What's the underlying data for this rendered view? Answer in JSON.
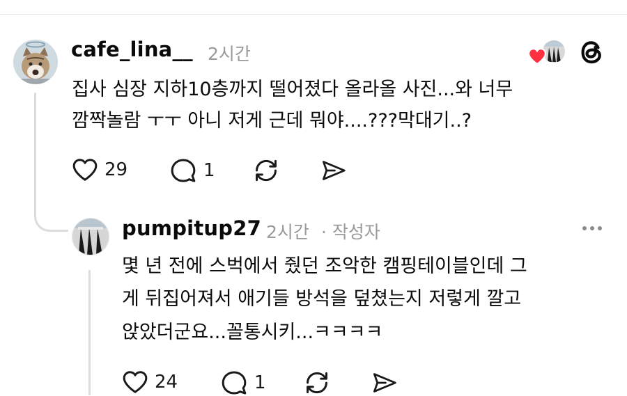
{
  "post": {
    "username": "cafe_lina__",
    "time": "2시간",
    "text_lines": [
      "집사 심장 지하10층까지 떨어졌다 올라올 사진...와 너무",
      "깜짝놀람 ㅜㅜ 아니 저게 근데 뭐야....???막대기..?"
    ],
    "likes": "29",
    "replies": "1"
  },
  "reply": {
    "username": "pumpitup27",
    "time": "2시간",
    "author_tag": "· 작성자",
    "text_lines": [
      "몇 년 전에 스벅에서 줬던 조악한 캠핑테이블인데 그",
      "게 뒤집어져서 애기들 방석을 덮쳤는지 저렇게 깔고",
      "앉았더군요...꼴통시키...ㅋㅋㅋㅋ"
    ],
    "likes": "24",
    "replies": "1"
  },
  "colors": {
    "text": "#0a0a0a",
    "meta": "#9a9a9a",
    "thread_line": "#dcdcdc",
    "heart": "#ff3040"
  },
  "icons": {
    "like": "heart-outline-icon",
    "reply": "speech-bubble-icon",
    "repost": "repost-arrows-icon",
    "share": "send-paper-plane-icon",
    "liked_by_author": "red-heart-badge-icon",
    "brand": "threads-logo-icon",
    "more": "more-dots-icon"
  }
}
